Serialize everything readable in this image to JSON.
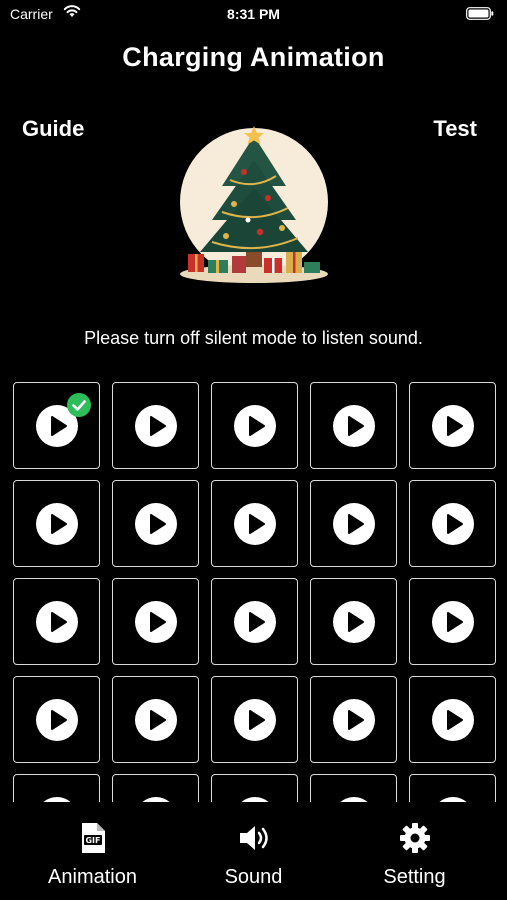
{
  "status_bar": {
    "carrier": "Carrier",
    "time": "8:31 PM",
    "wifi_icon": "wifi-icon",
    "battery_icon": "battery-icon"
  },
  "header": {
    "title": "Charging Animation",
    "guide_label": "Guide",
    "test_label": "Test"
  },
  "illustration": {
    "icon": "christmas-tree-icon"
  },
  "notice": "Please turn off silent mode to listen sound.",
  "sound_grid": {
    "columns": 5,
    "visible_rows": 5,
    "selected_index": 0,
    "tile_icon": "play-icon",
    "check_icon": "checkmark-icon"
  },
  "tab_bar": {
    "items": [
      {
        "label": "Animation",
        "icon": "gif-file-icon"
      },
      {
        "label": "Sound",
        "icon": "speaker-icon"
      },
      {
        "label": "Setting",
        "icon": "gear-icon"
      }
    ]
  },
  "colors": {
    "background": "#000000",
    "text": "#ffffff",
    "tile_border": "#d9d9d9",
    "check": "#2ebd59"
  }
}
